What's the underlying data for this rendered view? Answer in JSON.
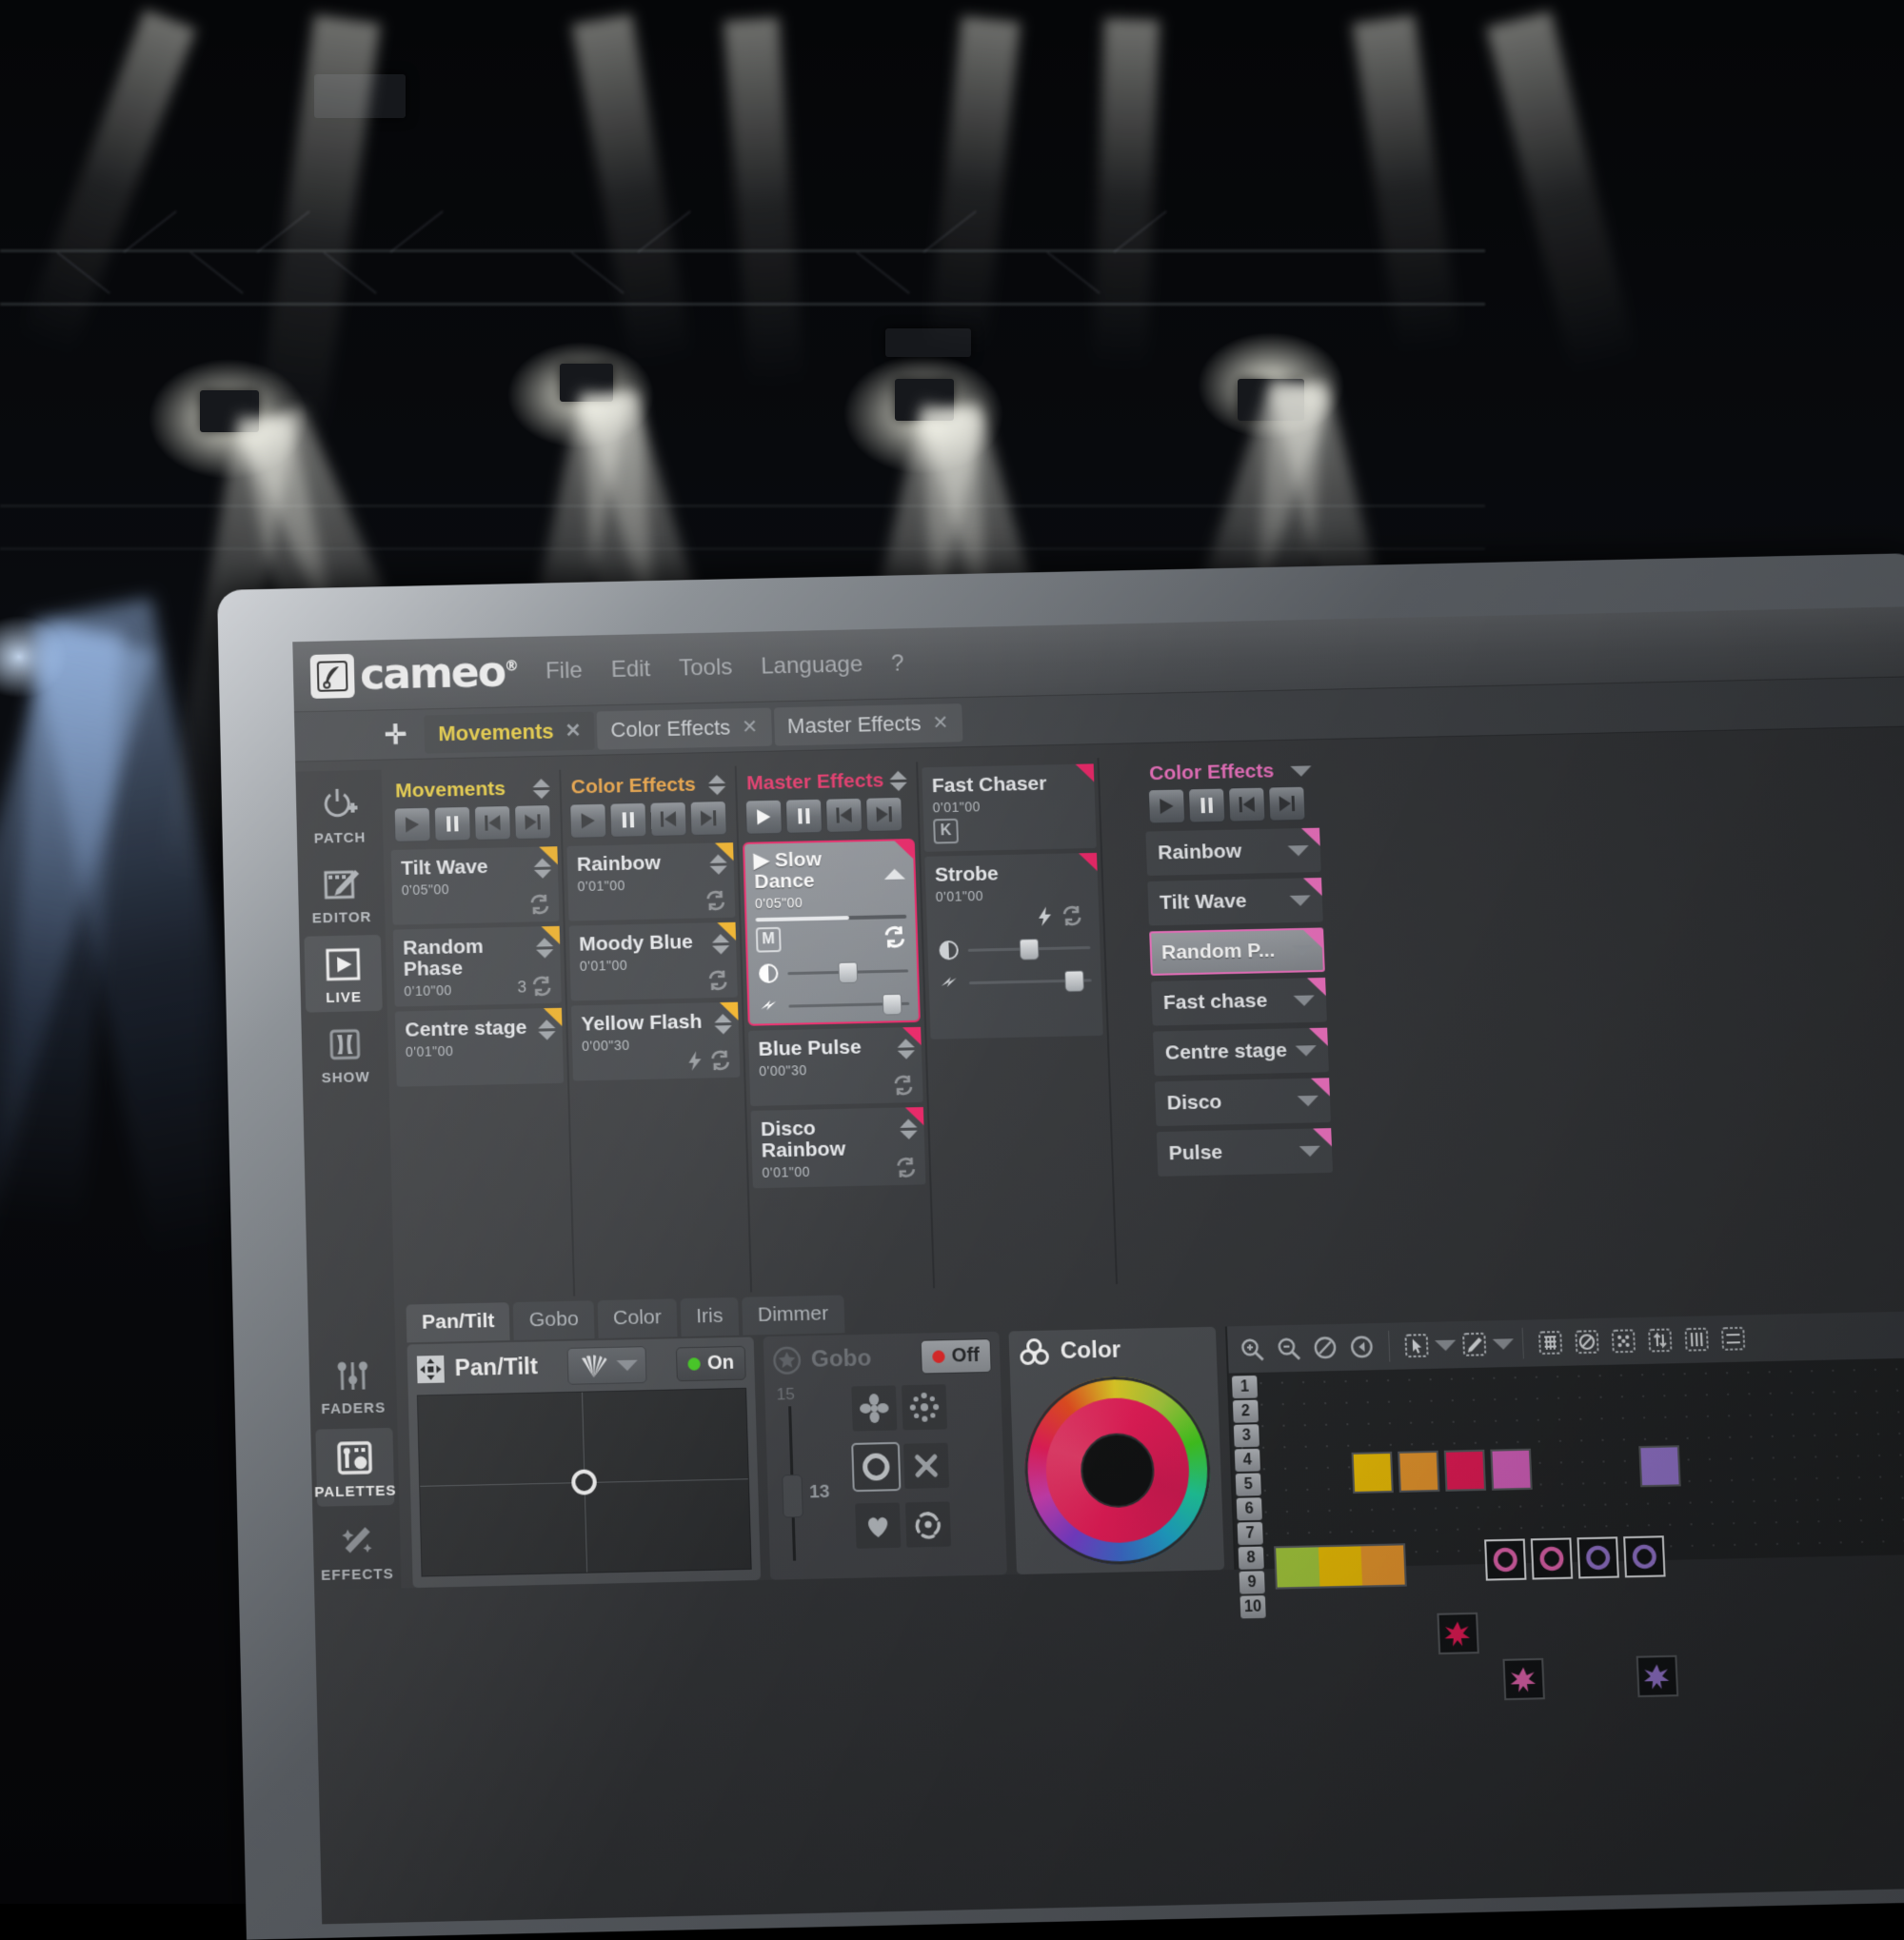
{
  "app": {
    "brand": "cameo",
    "brand_mark": "®",
    "menu": [
      "File",
      "Edit",
      "Tools",
      "Language",
      "?"
    ]
  },
  "tabs": {
    "add_label": "✛",
    "items": [
      {
        "label": "Movements",
        "active": true,
        "close": "✕"
      },
      {
        "label": "Color Effects",
        "active": false,
        "close": "✕"
      },
      {
        "label": "Master Effects",
        "active": false,
        "close": "✕"
      }
    ]
  },
  "left_rail": {
    "items": [
      {
        "label": "PATCH",
        "icon": "patch-icon",
        "selected": false
      },
      {
        "label": "EDITOR",
        "icon": "editor-icon",
        "selected": false
      },
      {
        "label": "LIVE",
        "icon": "live-play-icon",
        "selected": true
      },
      {
        "label": "SHOW",
        "icon": "show-curtain-icon",
        "selected": false
      },
      {
        "label": "FADERS",
        "icon": "faders-icon",
        "selected": false
      },
      {
        "label": "PALETTES",
        "icon": "palettes-icon",
        "selected": true
      },
      {
        "label": "EFFECTS",
        "icon": "effects-wand-icon",
        "selected": false
      }
    ]
  },
  "columns": [
    {
      "title": "Movements",
      "accent": "#f2d43a",
      "accent_class": "ttl-yellow",
      "transport": [
        "play",
        "pause",
        "prev",
        "next"
      ],
      "cards": [
        {
          "name": "Tilt Wave",
          "time": "0'05\"00",
          "corner": "yellow",
          "loop": true
        },
        {
          "name": "Random Phase",
          "time": "0'10\"00",
          "corner": "yellow",
          "loop": true,
          "loop_count": "3"
        },
        {
          "name": "Centre stage",
          "time": "0'01\"00",
          "corner": "yellow",
          "loop": false
        }
      ]
    },
    {
      "title": "Color Effects",
      "accent": "#f0a33c",
      "accent_class": "ttl-orange",
      "transport": [
        "play",
        "pause",
        "prev",
        "next"
      ],
      "cards": [
        {
          "name": "Rainbow",
          "time": "0'01\"00",
          "corner": "yellow",
          "loop": true
        },
        {
          "name": "Moody Blue",
          "time": "0'01\"00",
          "corner": "yellow",
          "loop": true
        },
        {
          "name": "Yellow Flash",
          "time": "0'00\"30",
          "corner": "yellow",
          "loop": true,
          "bolt": true
        }
      ]
    },
    {
      "title": "Master Effects",
      "accent": "#ea2f66",
      "accent_class": "ttl-pink",
      "transport": [
        "play",
        "pause",
        "prev",
        "next"
      ],
      "cards": [
        {
          "name": "Slow Dance",
          "time": "0'05\"00",
          "selected": true,
          "playing_glyph": "▶",
          "progress": 62,
          "badge": "M",
          "loop": true,
          "sliders": [
            {
              "icon": "contrast-icon",
              "value": 50
            },
            {
              "icon": "speed-icon",
              "value": 86
            }
          ]
        },
        {
          "name": "Blue Pulse",
          "time": "0'00\"30",
          "corner": "pink",
          "loop": true
        },
        {
          "name": "Disco Rainbow",
          "time": "0'01\"00",
          "corner": "pink",
          "loop": true
        }
      ]
    },
    {
      "title": "",
      "accent": "#ea2f66",
      "accent_class": "ttl-pink",
      "cards": [
        {
          "name": "Fast Chaser",
          "time": "0'01\"00",
          "corner": "pink",
          "badge": "K"
        },
        {
          "name": "Strobe",
          "time": "0'01\"00",
          "corner": "pink",
          "loop": true,
          "bolt": true,
          "sliders": [
            {
              "icon": "contrast-icon",
              "value": 50
            },
            {
              "icon": "speed-icon",
              "value": 86
            }
          ]
        }
      ]
    }
  ],
  "right_column": {
    "title": "Color Effects",
    "accent": "#f06ec0",
    "transport": [
      "play",
      "pause",
      "prev",
      "next"
    ],
    "items": [
      {
        "label": "Rainbow",
        "selected": false
      },
      {
        "label": "Tilt Wave",
        "selected": false
      },
      {
        "label": "Random P...",
        "selected": true
      },
      {
        "label": "Fast chase",
        "selected": false
      },
      {
        "label": "Centre stage",
        "selected": false
      },
      {
        "label": "Disco",
        "selected": false
      },
      {
        "label": "Pulse",
        "selected": false
      }
    ]
  },
  "bottom_tabs": [
    {
      "label": "Pan/Tilt",
      "active": true
    },
    {
      "label": "Gobo",
      "active": false
    },
    {
      "label": "Color",
      "active": false
    },
    {
      "label": "Iris",
      "active": false
    },
    {
      "label": "Dimmer",
      "active": false
    }
  ],
  "panels": {
    "pantilt": {
      "title": "Pan/Tilt",
      "icon": "move-arrows-icon",
      "toggle": "On",
      "toggle_state": "on",
      "toggle_color": "#3fd11a",
      "shape_icon": "fan-shape-icon"
    },
    "gobo": {
      "title": "Gobo",
      "icon": "gobo-star-icon",
      "toggle": "Off",
      "toggle_state": "off",
      "toggle_color": "#e22020",
      "slider_max": "15",
      "slider_value": "13"
    },
    "color": {
      "title": "Color",
      "icon": "color-rgb-icon"
    }
  },
  "right_toolbar": {
    "tools": [
      "zoom-in-icon",
      "zoom-out-icon",
      "zoom-reset-icon",
      "zoom-back-icon",
      "select-arrow-icon",
      "select-arrow-dropdown-icon",
      "pencil-icon",
      "pencil-dropdown-icon",
      "grid-icon",
      "no-entry-icon",
      "scatter-icon",
      "swap-icon",
      "align-icon",
      "distribute-icon"
    ]
  },
  "right_grid": {
    "row_numbers": [
      "1",
      "2",
      "3",
      "4",
      "5",
      "6",
      "7",
      "8",
      "9",
      "10"
    ],
    "swatches_row1": [
      "#f5c400",
      "#f09a2a",
      "#ee1756",
      "#de62c4"
    ],
    "swatch_far_right": "#9b79d8",
    "swatches_row2": [
      "#a8cf3a",
      "#f5c400",
      "#f09a2a"
    ],
    "gobo_icons": [
      {
        "name": "ring-icon",
        "color": "#ee66b5"
      },
      {
        "name": "ring-icon",
        "color": "#ee66b5"
      },
      {
        "name": "ring-icon",
        "color": "#9b79d8"
      },
      {
        "name": "ring-icon",
        "color": "#9b79d8"
      }
    ],
    "star_icons": [
      {
        "name": "star-burst-icon",
        "color": "#ee1756"
      },
      {
        "name": "star-burst-icon",
        "color": "#ee66b5"
      },
      {
        "name": "star-burst-icon",
        "color": "#9b79d8"
      }
    ]
  }
}
